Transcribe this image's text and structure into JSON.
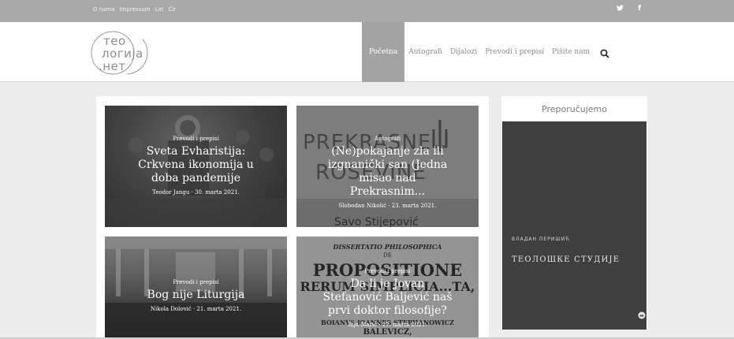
{
  "topbar": {
    "links": [
      "O nama",
      "Impressum",
      "Lat",
      "Ćir"
    ],
    "social": [
      "twitter-icon",
      "facebook-icon"
    ],
    "twitter_glyph": "🐦",
    "facebook_glyph": "f"
  },
  "logo": {
    "line1": "тео",
    "line2": "логија",
    "line3": ".нет"
  },
  "nav": {
    "items": [
      "Početna",
      "Autografi",
      "Dijalozi",
      "Prevodi i prepisi",
      "Pišite nam"
    ],
    "active": "Početna"
  },
  "cards": [
    {
      "category": "Prevodi i prepisi",
      "title": "Sveta Evharistija: Crkvena ikonomija u doba pandemije",
      "meta": "Teodor Jangu · 30. marta 2021."
    },
    {
      "category": "Autografi",
      "title": "(Ne)pokajanje zla ili izgnanički san (Jedna misao nad Prekrasnim...",
      "meta": "Slobodan Nikolić · 23. marta 2021.",
      "image_text_1": "PREKRASNE",
      "image_text_2": "ROSEVINE",
      "image_text_3": "Savo Stijepović"
    },
    {
      "category": "Prevodi i prepisi",
      "title": "Bog nije Liturgija",
      "meta": "Nikola Dolović · 21. marta 2021."
    },
    {
      "category": "Prevodi i prepisi",
      "title": "Da li je Jovan Stefanović Baljević naš prvi doktor filosofije?",
      "meta": "Ilija Marić · 17. marta 2021.",
      "image_text_1": "DISSERTATIO PHILOSOPHICA",
      "image_text_2": "DE",
      "image_text_3": "PROPOSITIONE",
      "image_text_4": "RERUM SIMPLICIA...TA,",
      "image_text_5": "BOIANVS IOANNES STEPHANOWICZ",
      "image_text_6": "BALEVICZ,"
    }
  ],
  "sidebar": {
    "heading": "Preporučujemo",
    "book_author": "ВЛАДАН ПЕРИШИЋ",
    "book_title": "ТЕОЛОШКЕ СТУДИЈЕ"
  }
}
